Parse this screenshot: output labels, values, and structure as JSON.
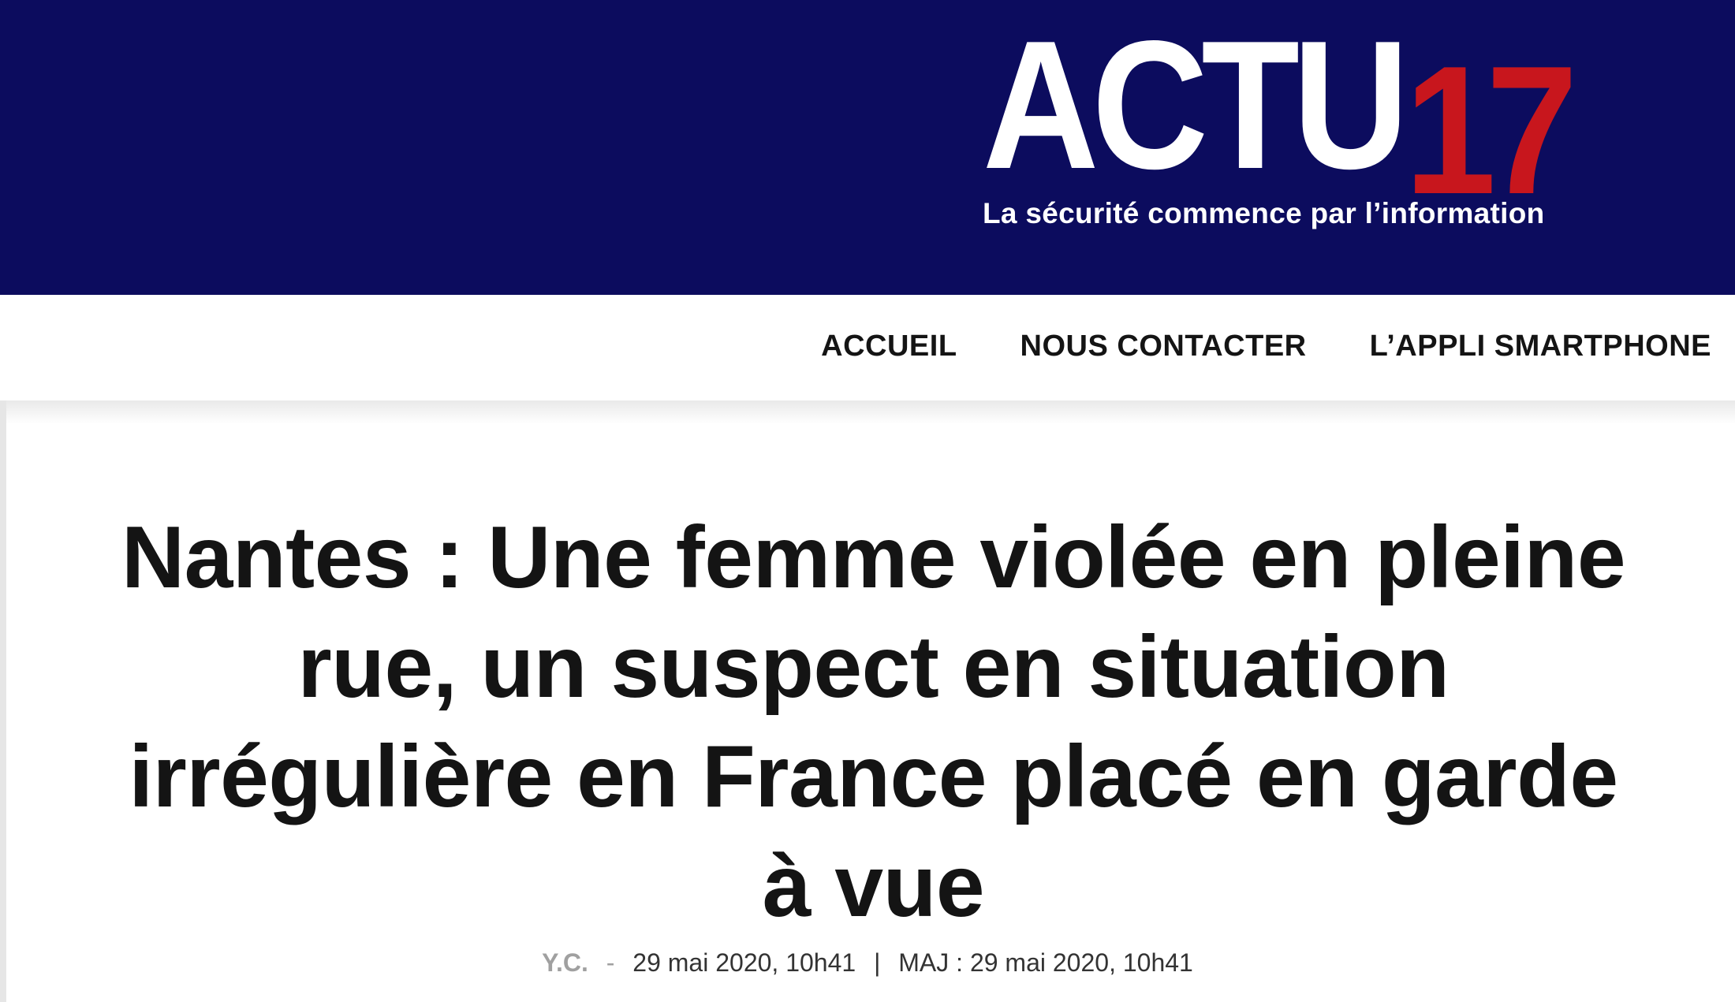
{
  "header": {
    "logo": {
      "brand": "ACTU",
      "number": "17",
      "tagline": "La sécurité commence par l’information"
    },
    "colors": {
      "background": "#0c0c5e",
      "brand": "#ffffff",
      "number": "#c8161d"
    }
  },
  "nav": {
    "items": [
      {
        "label": "ACCUEIL"
      },
      {
        "label": "NOUS CONTACTER"
      },
      {
        "label": "L’APPLI SMARTPHONE"
      }
    ]
  },
  "article": {
    "title": "Nantes : Une femme violée en pleine rue, un suspect en situation irrégulière en France placé en garde à vue",
    "author": "Y.C.",
    "separator": "-",
    "published": "29 mai 2020, 10h41",
    "divider": "|",
    "updated": "MAJ : 29 mai 2020, 10h41"
  }
}
